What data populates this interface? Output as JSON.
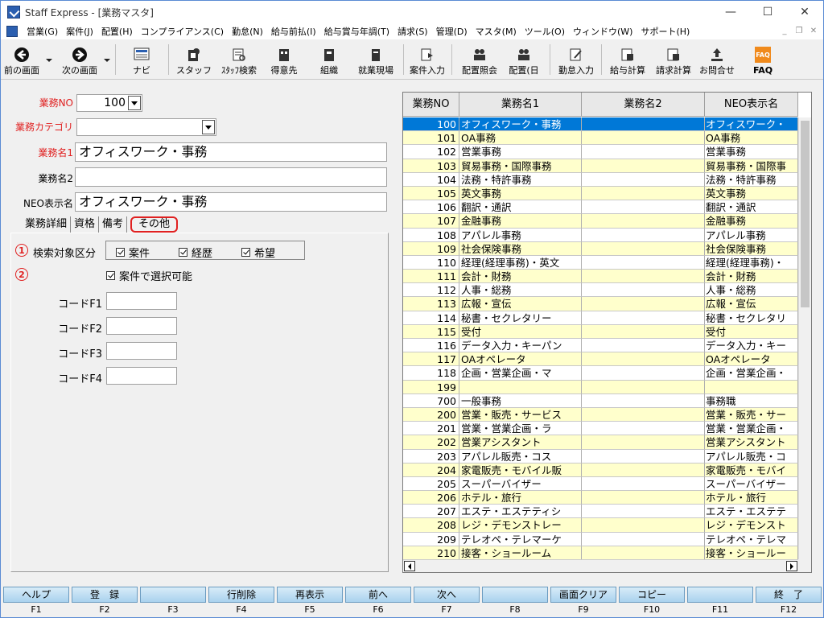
{
  "window": {
    "title": "Staff Express - [業務マスタ]"
  },
  "menu": [
    "営業(G)",
    "案件(J)",
    "配置(H)",
    "コンプライアンス(C)",
    "勤怠(N)",
    "給与前払(I)",
    "給与賞与年調(T)",
    "請求(S)",
    "管理(D)",
    "マスタ(M)",
    "ツール(O)",
    "ウィンドウ(W)",
    "サポート(H)"
  ],
  "toolbar": {
    "prev": "前の画面",
    "next": "次の画面",
    "navi": "ナビ",
    "staff": "スタッフ",
    "staff_search": "ｽﾀｯﾌ検索",
    "client": "得意先",
    "org": "組織",
    "site": "就業現場",
    "case_input": "案件入力",
    "assign_inquiry": "配置照会",
    "assign_day": "配置(日",
    "attendance": "勤怠入力",
    "salary_calc": "給与計算",
    "billing_calc": "請求計算",
    "contact": "お問合せ",
    "faq": "FAQ",
    "faq_icon": "FAQ"
  },
  "form": {
    "gyomu_no_label": "業務NO",
    "gyomu_no_value": "100",
    "category_label": "業務カテゴリ",
    "category_value": "",
    "name1_label": "業務名1",
    "name1_value": "オフィスワーク・事務",
    "name2_label": "業務名2",
    "name2_value": "",
    "neo_label": "NEO表示名",
    "neo_value": "オフィスワーク・事務"
  },
  "tabs": [
    "業務詳細",
    "資格",
    "備考",
    "その他"
  ],
  "other_tab": {
    "marker1": "1",
    "marker2": "2",
    "search_target_label": "検索対象区分",
    "chk_case": "案件",
    "chk_history": "経歴",
    "chk_wish": "希望",
    "selectable": "案件で選択可能",
    "code1": "コードF1",
    "code2": "コードF2",
    "code3": "コードF3",
    "code4": "コードF4",
    "code1_value": "",
    "code2_value": "",
    "code3_value": "",
    "code4_value": ""
  },
  "grid": {
    "headers": [
      "業務NO",
      "業務名1",
      "業務名2",
      "NEO表示名"
    ],
    "rows": [
      [
        "100",
        "オフィスワーク・事務",
        "",
        "オフィスワーク・"
      ],
      [
        "101",
        "OA事務",
        "",
        "OA事務"
      ],
      [
        "102",
        "営業事務",
        "",
        "営業事務"
      ],
      [
        "103",
        "貿易事務・国際事務",
        "",
        "貿易事務・国際事"
      ],
      [
        "104",
        "法務・特許事務",
        "",
        "法務・特許事務"
      ],
      [
        "105",
        "英文事務",
        "",
        "英文事務"
      ],
      [
        "106",
        "翻訳・通訳",
        "",
        "翻訳・通訳"
      ],
      [
        "107",
        "金融事務",
        "",
        "金融事務"
      ],
      [
        "108",
        "アパレル事務",
        "",
        "アパレル事務"
      ],
      [
        "109",
        "社会保険事務",
        "",
        "社会保険事務"
      ],
      [
        "110",
        "経理(経理事務)・英文",
        "",
        "経理(経理事務)・"
      ],
      [
        "111",
        "会計・財務",
        "",
        "会計・財務"
      ],
      [
        "112",
        "人事・総務",
        "",
        "人事・総務"
      ],
      [
        "113",
        "広報・宣伝",
        "",
        "広報・宣伝"
      ],
      [
        "114",
        "秘書・セクレタリー",
        "",
        "秘書・セクレタリ"
      ],
      [
        "115",
        "受付",
        "",
        "受付"
      ],
      [
        "116",
        "データ入力・キーパン",
        "",
        "データ入力・キー"
      ],
      [
        "117",
        "OAオペレータ",
        "",
        "OAオペレータ"
      ],
      [
        "118",
        "企画・営業企画・マ",
        "",
        "企画・営業企画・"
      ],
      [
        "199",
        "",
        "",
        ""
      ],
      [
        "700",
        "一般事務",
        "",
        "事務職"
      ],
      [
        "200",
        "営業・販売・サービス",
        "",
        "営業・販売・サー"
      ],
      [
        "201",
        "営業・営業企画・ラ",
        "",
        "営業・営業企画・"
      ],
      [
        "202",
        "営業アシスタント",
        "",
        "営業アシスタント"
      ],
      [
        "203",
        "アパレル販売・コス",
        "",
        "アパレル販売・コ"
      ],
      [
        "204",
        "家電販売・モバイル販",
        "",
        "家電販売・モバイ"
      ],
      [
        "205",
        "スーパーバイザー",
        "",
        "スーパーバイザー"
      ],
      [
        "206",
        "ホテル・旅行",
        "",
        "ホテル・旅行"
      ],
      [
        "207",
        "エステ・エステティシ",
        "",
        "エステ・エステテ"
      ],
      [
        "208",
        "レジ・デモンストレー",
        "",
        "レジ・デモンスト"
      ],
      [
        "209",
        "テレオペ・テレマーケ",
        "",
        "テレオペ・テレマ"
      ],
      [
        "210",
        "接客・ショールーム",
        "",
        "接客・ショールー"
      ]
    ]
  },
  "fkeys": [
    {
      "label": "ヘルプ",
      "key": "F1"
    },
    {
      "label": "登　録",
      "key": "F2"
    },
    {
      "label": "",
      "key": "F3"
    },
    {
      "label": "行削除",
      "key": "F4"
    },
    {
      "label": "再表示",
      "key": "F5"
    },
    {
      "label": "前へ",
      "key": "F6"
    },
    {
      "label": "次へ",
      "key": "F7"
    },
    {
      "label": "",
      "key": "F8"
    },
    {
      "label": "画面クリア",
      "key": "F9"
    },
    {
      "label": "コピー",
      "key": "F10"
    },
    {
      "label": "",
      "key": "F11"
    },
    {
      "label": "終　了",
      "key": "F12"
    }
  ]
}
